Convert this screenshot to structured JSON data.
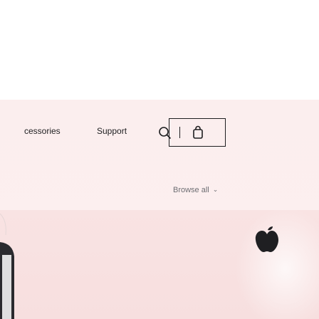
{
  "nav": {
    "items": [
      {
        "label": "cessories"
      },
      {
        "label": "Support"
      }
    ],
    "search_icon": "search-icon",
    "bag_icon": "shopping-bag-icon"
  },
  "browse": {
    "label": "Browse all",
    "chevron": "⌄"
  },
  "hero": {
    "logo_icon": "apple-logo-icon",
    "colors": {
      "band": "#fbeeee",
      "panel": "#f9e3e3",
      "text": "#1d1d1f",
      "muted": "#6e6e73"
    }
  }
}
